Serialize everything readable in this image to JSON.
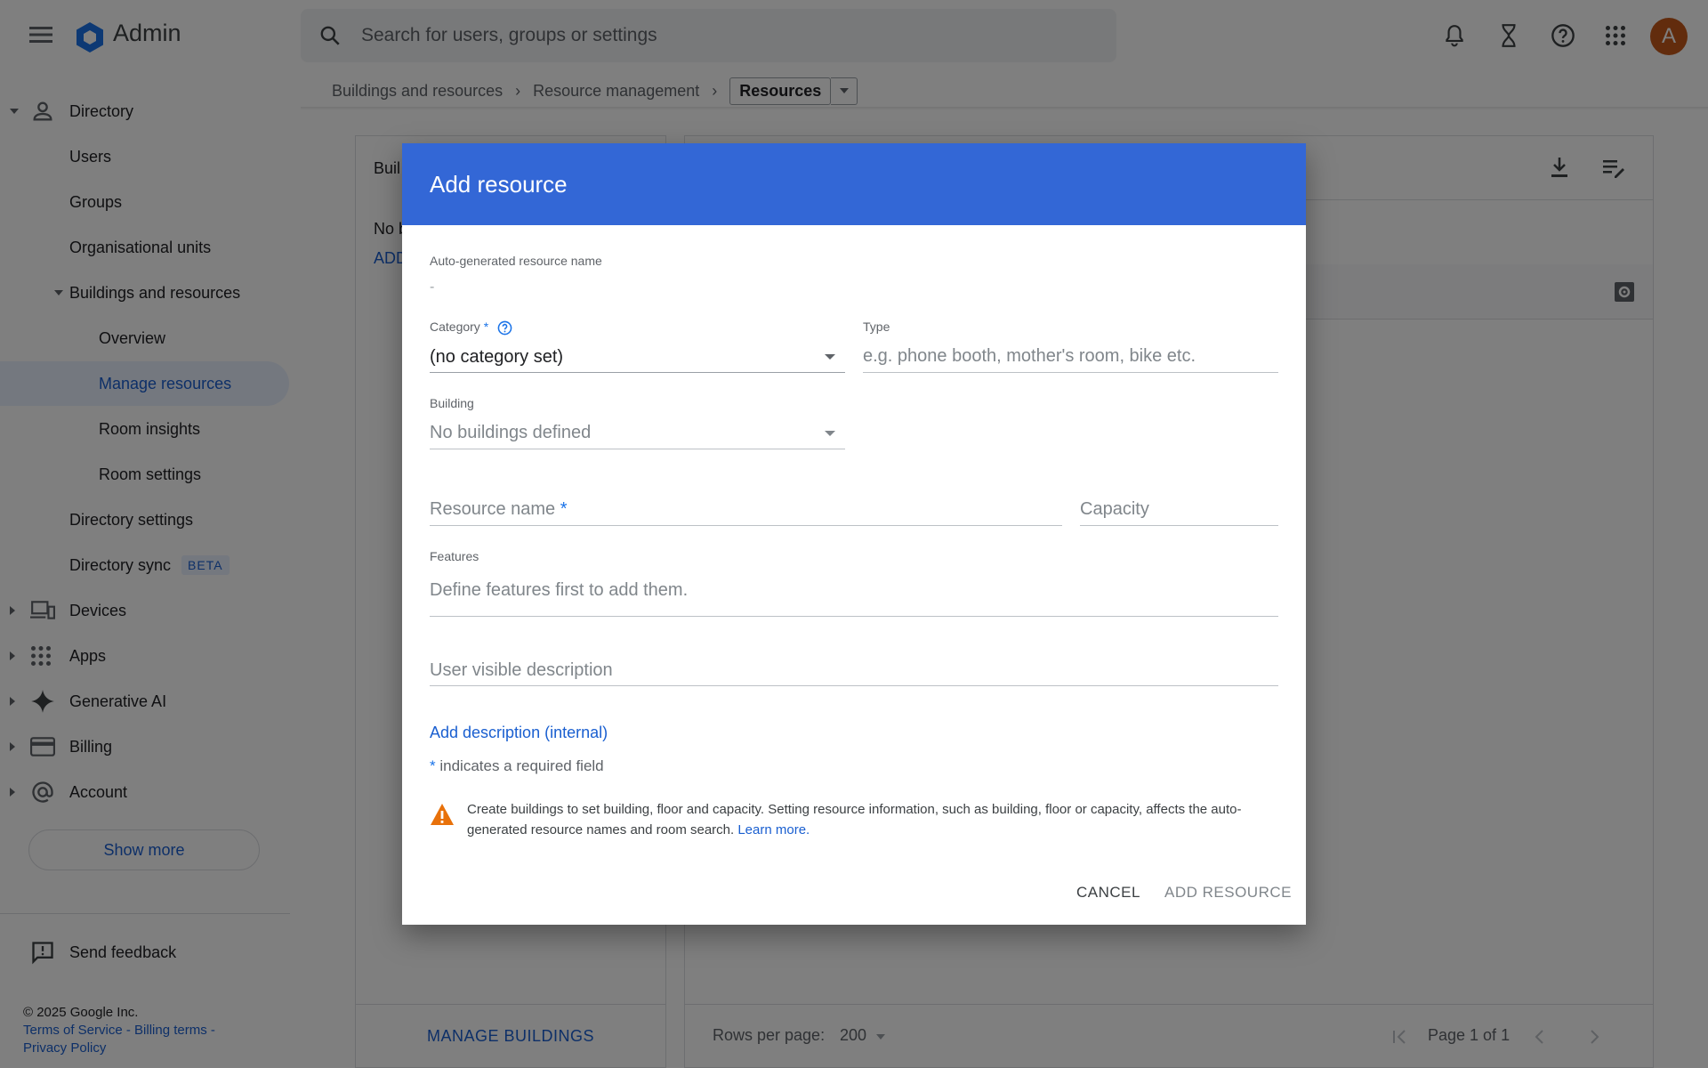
{
  "app": {
    "title": "Admin",
    "avatar_letter": "A",
    "avatar_color": "#c5581a",
    "accent": "#3367d6"
  },
  "search": {
    "placeholder": "Search for users, groups or settings"
  },
  "top_icons": [
    "notifications-icon",
    "hourglass-icon",
    "help-icon",
    "apps-grid-icon"
  ],
  "breadcrumb": {
    "items": [
      "Buildings and resources",
      "Resource management"
    ],
    "current": "Resources"
  },
  "sidebar": {
    "items": [
      {
        "label": "Directory"
      },
      {
        "label": "Users"
      },
      {
        "label": "Groups"
      },
      {
        "label": "Organisational units"
      },
      {
        "label": "Buildings and resources"
      },
      {
        "label": "Overview"
      },
      {
        "label": "Manage resources"
      },
      {
        "label": "Room insights"
      },
      {
        "label": "Room settings"
      },
      {
        "label": "Directory settings"
      },
      {
        "label": "Directory sync",
        "badge": "BETA"
      },
      {
        "label": "Devices"
      },
      {
        "label": "Apps"
      },
      {
        "label": "Generative AI"
      },
      {
        "label": "Billing"
      },
      {
        "label": "Account"
      }
    ],
    "show_more": "Show more",
    "feedback": "Send feedback",
    "footer": {
      "copyright": "© 2025 Google Inc.",
      "terms": "Terms of Service",
      "billing_terms": "Billing terms",
      "privacy": "Privacy Policy"
    }
  },
  "background": {
    "left_panel": {
      "title": "Buil",
      "empty": "No b",
      "add": "ADD",
      "footer_button": "MANAGE BUILDINGS"
    },
    "right_panel": {
      "rows_per_page_label": "Rows per page:",
      "rows_per_page_value": "200",
      "page_label": "Page 1 of 1"
    }
  },
  "dialog": {
    "title": "Add resource",
    "auto_name_label": "Auto-generated resource name",
    "auto_name_value": "-",
    "category_label": "Category",
    "category_value": "(no category set)",
    "type_label": "Type",
    "type_placeholder": "e.g. phone booth, mother's room, bike etc.",
    "building_label": "Building",
    "building_value": "No buildings defined",
    "resource_name_placeholder": "Resource name",
    "required_mark": "*",
    "capacity_placeholder": "Capacity",
    "features_label": "Features",
    "features_placeholder": "Define features first to add them.",
    "user_desc_placeholder": "User visible description",
    "add_description_link": "Add description (internal)",
    "required_note": "indicates a required field",
    "warning_text": "Create buildings to set building, floor and capacity. Setting resource information, such as building, floor or capacity, affects the auto-generated resource names and room search.",
    "warning_link": "Learn more.",
    "cancel_button": "CANCEL",
    "add_button": "ADD RESOURCE"
  }
}
